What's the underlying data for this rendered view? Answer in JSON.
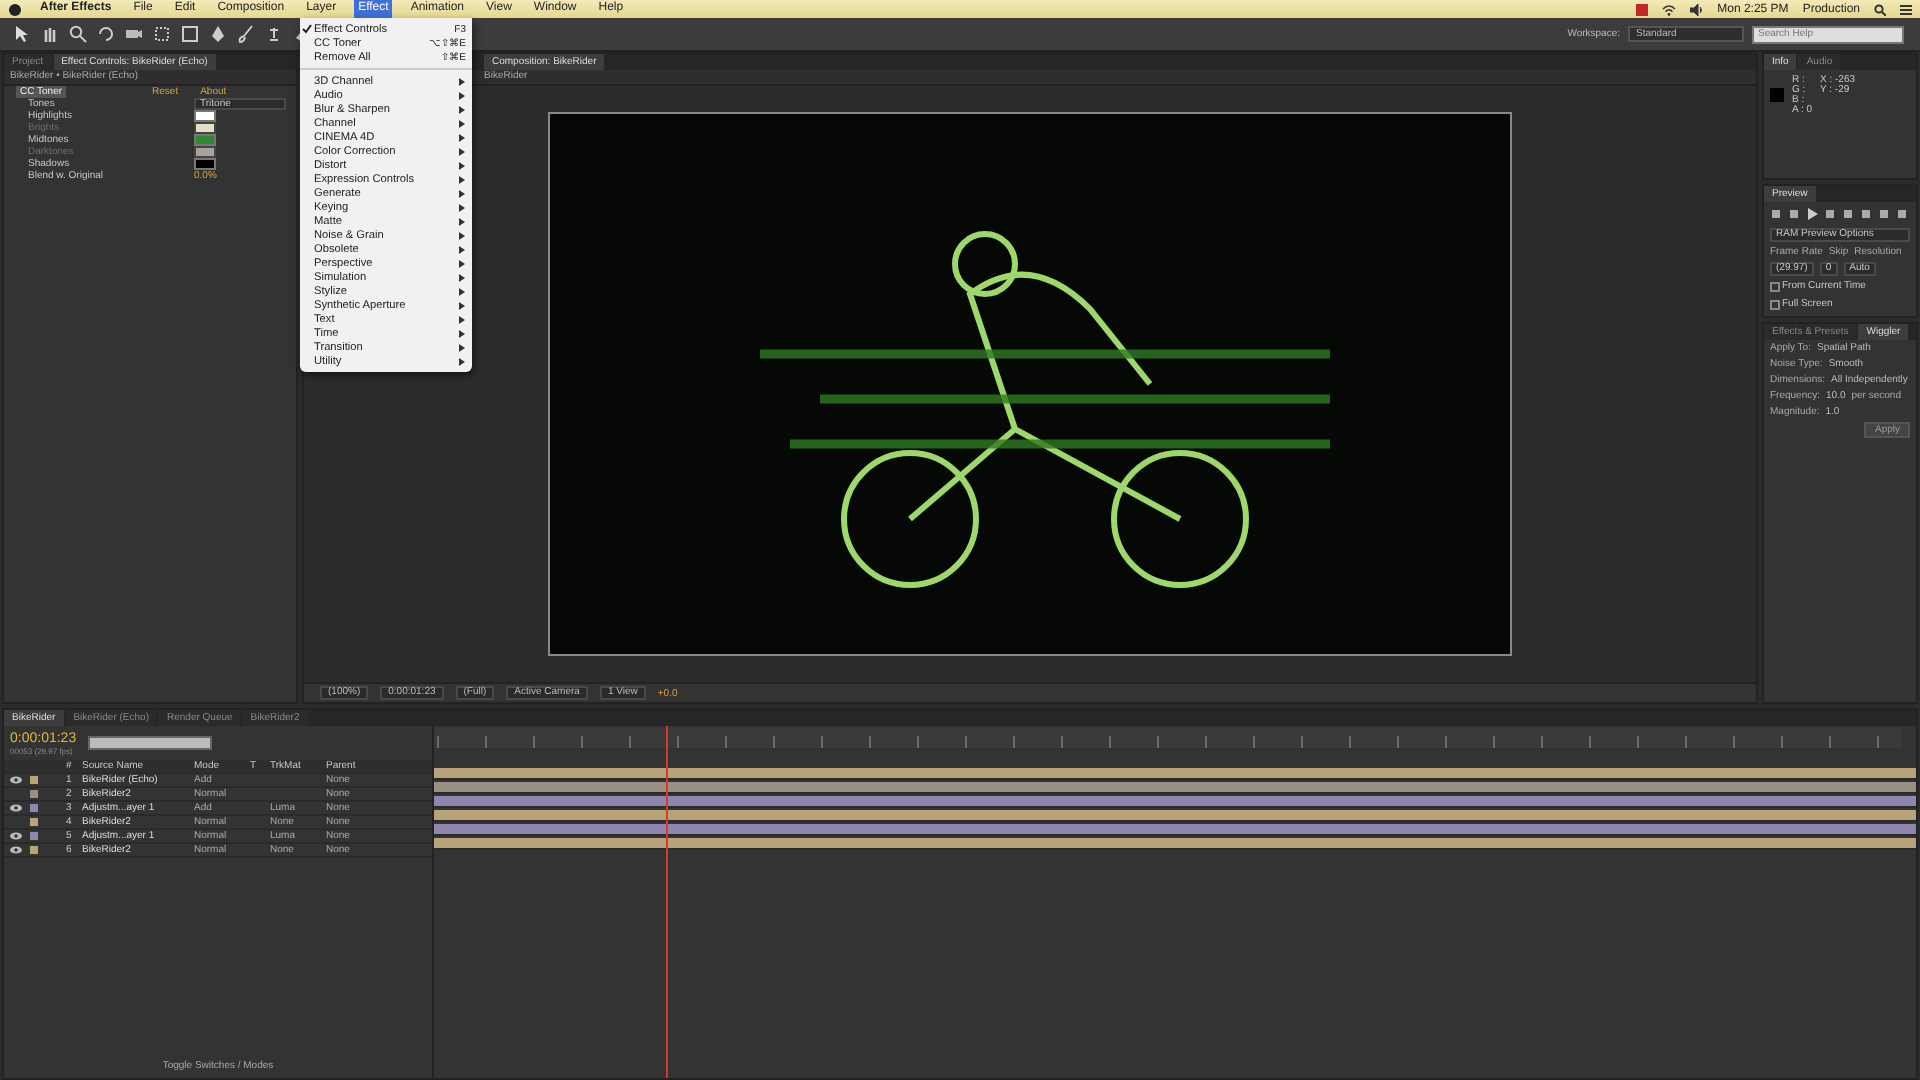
{
  "menubar": {
    "items": [
      {
        "label": "After Effects",
        "selected": false
      },
      {
        "label": "File",
        "selected": false
      },
      {
        "label": "Edit",
        "selected": false
      },
      {
        "label": "Composition",
        "selected": false
      },
      {
        "label": "Layer",
        "selected": false
      },
      {
        "label": "Effect",
        "selected": true
      },
      {
        "label": "Animation",
        "selected": false
      },
      {
        "label": "View",
        "selected": false
      },
      {
        "label": "Window",
        "selected": false
      },
      {
        "label": "Help",
        "selected": false
      }
    ],
    "clock": "Mon 2:25 PM",
    "user": "Production"
  },
  "effect_menu": {
    "items": [
      {
        "kind": "command",
        "label": "Effect Controls",
        "shortcut": "F3",
        "checked": true
      },
      {
        "kind": "command",
        "label": "CC Toner",
        "shortcut": "⌥⇧⌘E",
        "checked": false
      },
      {
        "kind": "command",
        "label": "Remove All",
        "shortcut": "⇧⌘E",
        "checked": false
      },
      {
        "kind": "separator"
      },
      {
        "kind": "submenu",
        "label": "3D Channel"
      },
      {
        "kind": "submenu",
        "label": "Audio"
      },
      {
        "kind": "submenu",
        "label": "Blur & Sharpen"
      },
      {
        "kind": "submenu",
        "label": "Channel"
      },
      {
        "kind": "submenu",
        "label": "CINEMA 4D"
      },
      {
        "kind": "submenu",
        "label": "Color Correction"
      },
      {
        "kind": "submenu",
        "label": "Distort"
      },
      {
        "kind": "submenu",
        "label": "Expression Controls"
      },
      {
        "kind": "submenu",
        "label": "Generate"
      },
      {
        "kind": "submenu",
        "label": "Keying"
      },
      {
        "kind": "submenu",
        "label": "Matte"
      },
      {
        "kind": "submenu",
        "label": "Noise & Grain"
      },
      {
        "kind": "submenu",
        "label": "Obsolete"
      },
      {
        "kind": "submenu",
        "label": "Perspective"
      },
      {
        "kind": "submenu",
        "label": "Simulation"
      },
      {
        "kind": "submenu",
        "label": "Stylize"
      },
      {
        "kind": "submenu",
        "label": "Synthetic Aperture"
      },
      {
        "kind": "submenu",
        "label": "Text"
      },
      {
        "kind": "submenu",
        "label": "Time"
      },
      {
        "kind": "submenu",
        "label": "Transition"
      },
      {
        "kind": "submenu",
        "label": "Utility"
      }
    ]
  },
  "toolbar": {
    "workspace_label": "Workspace:",
    "workspace": "Standard",
    "search": {
      "placeholder": "Search Help"
    }
  },
  "effect_controls": {
    "tabs": [
      {
        "label": "Project",
        "selected": false
      },
      {
        "label": "Effect Controls: BikeRider (Echo)",
        "selected": true
      }
    ],
    "breadcrumb": "BikeRider • BikeRider (Echo)",
    "effect": {
      "name": "CC Toner",
      "reset": "Reset",
      "about": "About"
    },
    "params": [
      {
        "kind": "dropdown",
        "label": "Tones",
        "value": "Tritone"
      },
      {
        "kind": "color",
        "label": "Highlights",
        "color": "#ffffff",
        "disabled": false
      },
      {
        "kind": "color",
        "label": "Brights",
        "color": "#e6e0c8",
        "disabled": true
      },
      {
        "kind": "color",
        "label": "Midtones",
        "color": "#2f8a2f",
        "disabled": false
      },
      {
        "kind": "color",
        "label": "Darktones",
        "color": "#a8a29a",
        "disabled": true
      },
      {
        "kind": "color",
        "label": "Shadows",
        "color": "#000000",
        "disabled": false
      },
      {
        "kind": "value",
        "label": "Blend w. Original",
        "value": "0.0%"
      }
    ]
  },
  "composition": {
    "tabs": [
      {
        "label": "Composition: BikeRider",
        "selected": true
      }
    ],
    "breadcrumb": "BikeRider",
    "footer": {
      "zoom": "(100%)",
      "time": "0:00:01:23",
      "resolution": "(Full)",
      "camera": "Active Camera",
      "views": "1 View",
      "exposure": "+0.0"
    }
  },
  "info": {
    "tabs": [
      {
        "label": "Info",
        "selected": true
      },
      {
        "label": "Audio",
        "selected": false
      }
    ],
    "channels": [
      "R :",
      "G :",
      "B :",
      "A : 0"
    ],
    "coords": [
      "X : -263",
      "Y : -29"
    ]
  },
  "preview": {
    "tab": "Preview",
    "options": "RAM Preview Options",
    "labels": [
      "Frame Rate",
      "Skip",
      "Resolution"
    ],
    "frame_rate": "(29.97)",
    "skip": "0",
    "resolution": "Auto",
    "from_current_time": {
      "label": "From Current Time",
      "checked": false
    },
    "full_screen": {
      "label": "Full Screen",
      "checked": false
    }
  },
  "effects_panel": {
    "tabs": [
      {
        "label": "Effects & Presets",
        "selected": false
      },
      {
        "label": "Wiggler",
        "selected": true
      }
    ],
    "fields": [
      {
        "label": "Apply To:",
        "value": "Spatial Path"
      },
      {
        "label": "Noise Type:",
        "value": "Smooth"
      },
      {
        "label": "Dimensions:",
        "value": "All Independently"
      },
      {
        "label": "Frequency:",
        "value": "10.0",
        "unit": "per second"
      },
      {
        "label": "Magnitude:",
        "value": "1.0"
      }
    ],
    "apply": "Apply"
  },
  "timeline": {
    "tabs": [
      {
        "label": "BikeRider",
        "selected": true
      },
      {
        "label": "BikeRider (Echo)",
        "selected": false
      },
      {
        "label": "Render Queue",
        "selected": false
      },
      {
        "label": "BikeRider2",
        "selected": false
      }
    ],
    "time": "0:00:01:23",
    "frame": "00053 (29.97 fps)",
    "columns": [
      "#",
      "Source Name",
      "Mode",
      "T",
      "TrkMat",
      "Parent"
    ],
    "layers": [
      {
        "number": "1",
        "name": "BikeRider (Echo)",
        "mode": "Add",
        "parent": "None",
        "visible": true,
        "color": "#b8a27a"
      },
      {
        "number": "2",
        "name": "BikeRider2",
        "mode": "Normal",
        "parent": "None",
        "visible": false,
        "color": "#9a9080"
      },
      {
        "number": "3",
        "name": "Adjustm...ayer 1",
        "mode": "Add",
        "trkmat": "Luma",
        "parent": "None",
        "visible": true,
        "color": "#8f86b0"
      },
      {
        "number": "4",
        "name": "BikeRider2",
        "mode": "Normal",
        "trkmat": "None",
        "parent": "None",
        "visible": false,
        "color": "#b8a27a"
      },
      {
        "number": "5",
        "name": "Adjustm...ayer 1",
        "mode": "Normal",
        "trkmat": "Luma",
        "parent": "None",
        "visible": true,
        "color": "#8f86b0"
      },
      {
        "number": "6",
        "name": "BikeRider2",
        "mode": "Normal",
        "trkmat": "None",
        "parent": "None",
        "visible": true,
        "color": "#b8a27a"
      }
    ],
    "footer": "Toggle Switches / Modes"
  }
}
